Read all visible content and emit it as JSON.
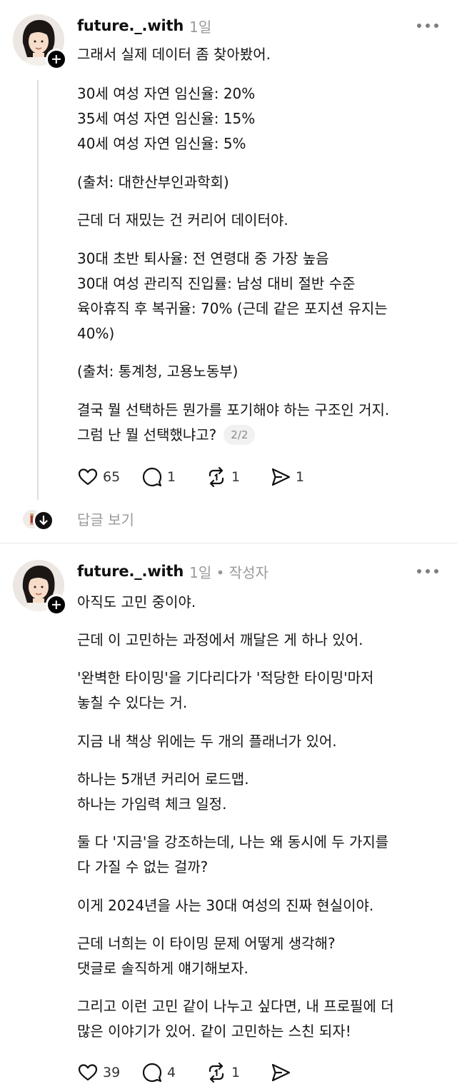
{
  "post1": {
    "username": "future._.with",
    "meta": "1일",
    "lines": [
      "그래서 실제 데이터 좀 찾아봤어.",
      "30세 여성 자연 임신율: 20%",
      "35세 여성 자연 임신율: 15%",
      "40세 여성 자연 임신율: 5%",
      "(출처: 대한산부인과학회)",
      "근데 더 재밌는 건 커리어 데이터야.",
      "30대 초반 퇴사율: 전 연령대 중 가장 높음",
      "30대 여성 관리직 진입률: 남성 대비 절반 수준",
      "육아휴직 후 복귀율: 70% (근데 같은 포지션 유지는",
      "40%)",
      "(출처: 통계청, 고용노동부)",
      "결국 뭘 선택하든 뭔가를 포기해야 하는 구조인 거지.",
      "그럼 난 뭘 선택했냐고?"
    ],
    "page_badge": "2/2",
    "likes": "65",
    "comments": "1",
    "reposts": "1",
    "shares": "1"
  },
  "replies": {
    "label": "답글 보기"
  },
  "post2": {
    "username": "future._.with",
    "meta": "1일 • 작성자",
    "lines": [
      "아직도 고민 중이야.",
      "근데 이 고민하는 과정에서 깨달은 게 하나 있어.",
      "'완벽한 타이밍'을 기다리다가 '적당한 타이밍'마저",
      "놓칠 수 있다는 거.",
      "지금 내 책상 위에는 두 개의 플래너가 있어.",
      "하나는 5개년 커리어 로드맵.",
      "하나는 가임력 체크 일정.",
      "둘 다 '지금'을 강조하는데, 나는 왜 동시에 두 가지를",
      "다 가질 수 없는 걸까?",
      "이게 2024년을 사는 30대 여성의 진짜 현실이야.",
      "근데 너희는 이 타이밍 문제 어떻게 생각해?",
      "댓글로 솔직하게 얘기해보자.",
      "그리고 이런 고민 같이 나누고 싶다면, 내 프로필에 더",
      "많은 이야기가 있어. 같이 고민하는 스친 되자!"
    ],
    "likes": "39",
    "comments": "4",
    "reposts": "1"
  },
  "icons": [
    "heart-icon",
    "comment-icon",
    "repost-icon",
    "send-icon",
    "more-icon",
    "follow-plus-icon",
    "expand-down-icon"
  ]
}
